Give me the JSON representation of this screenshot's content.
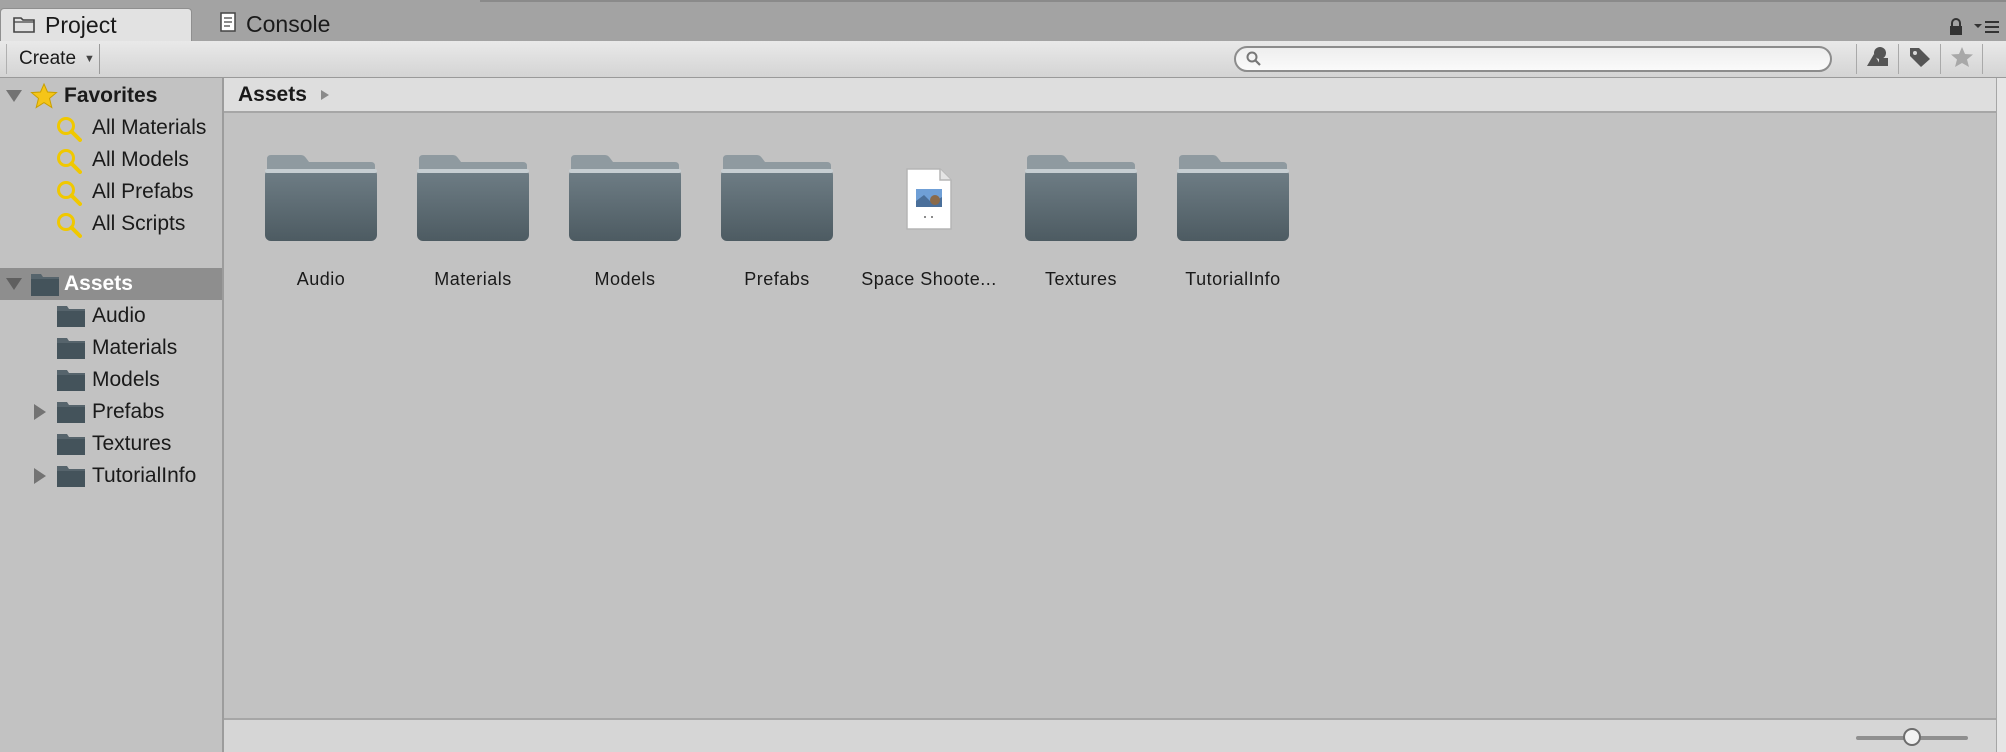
{
  "tabs": [
    {
      "label": "Project",
      "icon": "folder-icon",
      "active": true
    },
    {
      "label": "Console",
      "icon": "console-icon",
      "active": false
    }
  ],
  "toolbar": {
    "create_label": "Create",
    "search_placeholder": "",
    "search_value": ""
  },
  "sidebar": {
    "favorites": {
      "label": "Favorites",
      "items": [
        {
          "label": "All Materials"
        },
        {
          "label": "All Models"
        },
        {
          "label": "All Prefabs"
        },
        {
          "label": "All Scripts"
        }
      ]
    },
    "assets": {
      "label": "Assets",
      "items": [
        {
          "label": "Audio",
          "expandable": false
        },
        {
          "label": "Materials",
          "expandable": false
        },
        {
          "label": "Models",
          "expandable": false
        },
        {
          "label": "Prefabs",
          "expandable": true
        },
        {
          "label": "Textures",
          "expandable": false
        },
        {
          "label": "TutorialInfo",
          "expandable": true
        }
      ]
    }
  },
  "breadcrumb": {
    "label": "Assets"
  },
  "assets_grid": [
    {
      "label": "Audio",
      "kind": "folder"
    },
    {
      "label": "Materials",
      "kind": "folder"
    },
    {
      "label": "Models",
      "kind": "folder"
    },
    {
      "label": "Prefabs",
      "kind": "folder"
    },
    {
      "label": "Space Shoote...",
      "kind": "scene"
    },
    {
      "label": "Textures",
      "kind": "folder"
    },
    {
      "label": "TutorialInfo",
      "kind": "folder"
    }
  ],
  "zoom_slider": {
    "value": 0.5
  },
  "colors": {
    "folder": "#5c6a72",
    "selected_row": "#8e8e8e",
    "star": "#f5c518",
    "search_lens": "#f0c800"
  }
}
